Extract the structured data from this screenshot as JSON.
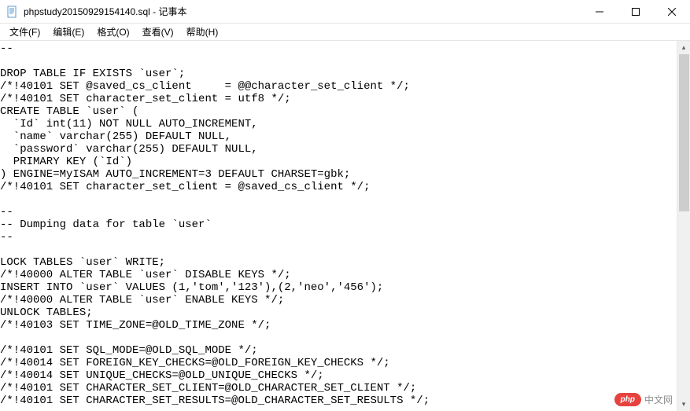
{
  "window": {
    "title": "phpstudy20150929154140.sql - 记事本"
  },
  "menu": {
    "file": "文件(F)",
    "edit": "编辑(E)",
    "format": "格式(O)",
    "view": "查看(V)",
    "help": "帮助(H)"
  },
  "content": {
    "text": "--\n\nDROP TABLE IF EXISTS `user`;\n/*!40101 SET @saved_cs_client     = @@character_set_client */;\n/*!40101 SET character_set_client = utf8 */;\nCREATE TABLE `user` (\n  `Id` int(11) NOT NULL AUTO_INCREMENT,\n  `name` varchar(255) DEFAULT NULL,\n  `password` varchar(255) DEFAULT NULL,\n  PRIMARY KEY (`Id`)\n) ENGINE=MyISAM AUTO_INCREMENT=3 DEFAULT CHARSET=gbk;\n/*!40101 SET character_set_client = @saved_cs_client */;\n\n--\n-- Dumping data for table `user`\n--\n\nLOCK TABLES `user` WRITE;\n/*!40000 ALTER TABLE `user` DISABLE KEYS */;\nINSERT INTO `user` VALUES (1,'tom','123'),(2,'neo','456');\n/*!40000 ALTER TABLE `user` ENABLE KEYS */;\nUNLOCK TABLES;\n/*!40103 SET TIME_ZONE=@OLD_TIME_ZONE */;\n\n/*!40101 SET SQL_MODE=@OLD_SQL_MODE */;\n/*!40014 SET FOREIGN_KEY_CHECKS=@OLD_FOREIGN_KEY_CHECKS */;\n/*!40014 SET UNIQUE_CHECKS=@OLD_UNIQUE_CHECKS */;\n/*!40101 SET CHARACTER_SET_CLIENT=@OLD_CHARACTER_SET_CLIENT */;\n/*!40101 SET CHARACTER_SET_RESULTS=@OLD_CHARACTER_SET_RESULTS */;"
  },
  "watermark": {
    "badge": "php",
    "text": "中文网"
  }
}
